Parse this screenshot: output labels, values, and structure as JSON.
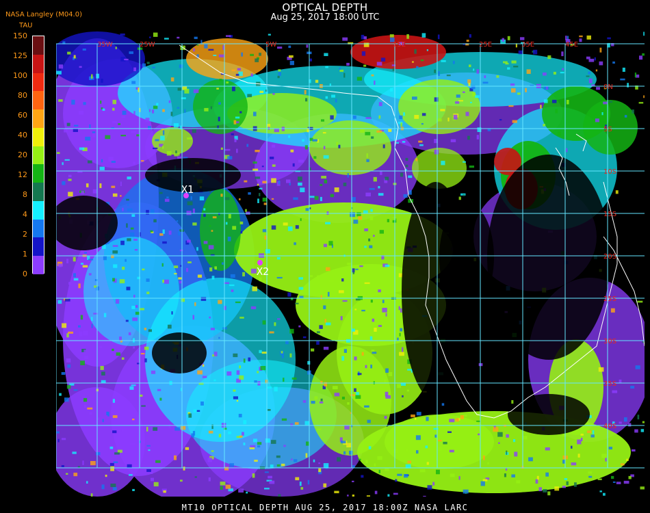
{
  "header": {
    "title": "OPTICAL DEPTH",
    "subtitle": "Aug 25, 2017 18:00 UTC",
    "source": "NASA Langley (M04.0)"
  },
  "legend": {
    "title": "TAU",
    "ticks": [
      "150",
      "125",
      "100",
      "80",
      "60",
      "40",
      "20",
      "12",
      "8",
      "4",
      "2",
      "1",
      "0"
    ],
    "colors": [
      "#6a0f12",
      "#c81414",
      "#f02a10",
      "#ff6410",
      "#ffa514",
      "#f0f00a",
      "#96f014",
      "#14b414",
      "#147850",
      "#14f0ff",
      "#1478f0",
      "#1414c8",
      "#8c3cff"
    ]
  },
  "map": {
    "markers": [
      {
        "label": "X1"
      },
      {
        "label": "X2"
      }
    ],
    "longitude_labels": [
      "35W",
      "25W",
      "5W",
      "15E",
      "25E",
      "35E",
      "45E"
    ],
    "latitude_labels": [
      "0N",
      "5S",
      "10S",
      "15S",
      "20S",
      "25S",
      "30S",
      "35S",
      "40S"
    ],
    "colors": {
      "grid": "#64e6ff",
      "coast": "#ffffff",
      "marker": "#e040ff",
      "background": "#000000"
    }
  },
  "footer": {
    "text": "MT10  OPTICAL DEPTH   AUG 25, 2017 18:00Z   NASA LARC"
  }
}
